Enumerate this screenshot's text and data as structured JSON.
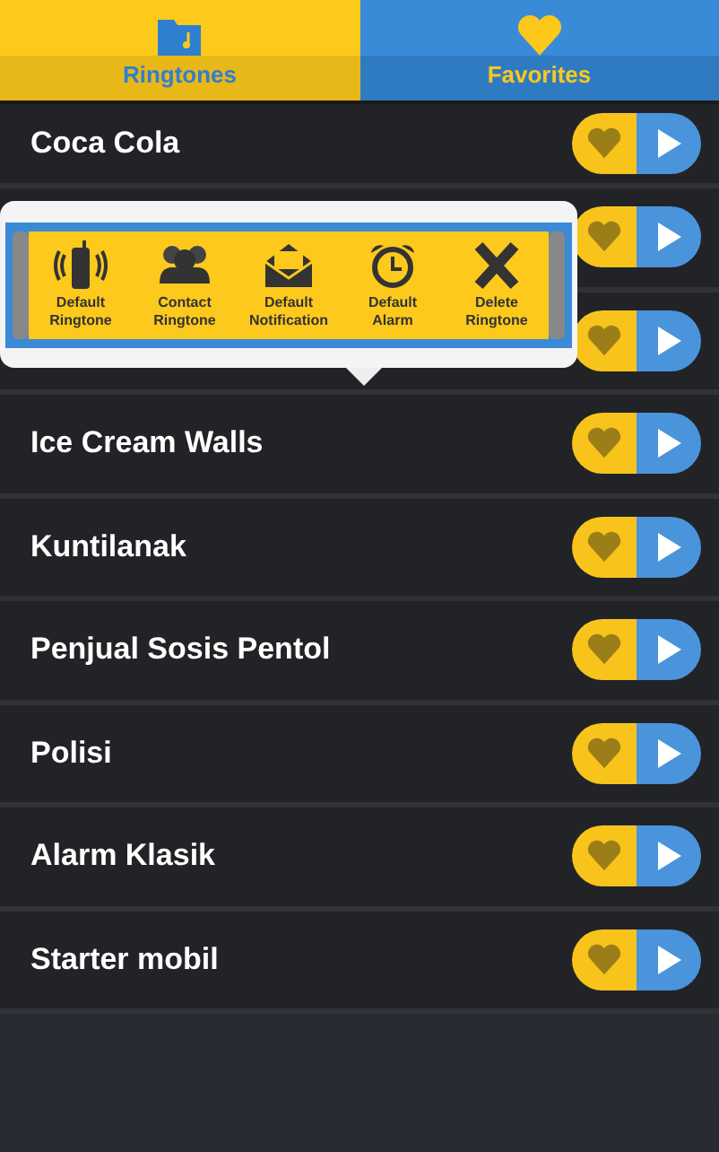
{
  "tabs": [
    {
      "label": "Ringtones",
      "selected": true
    },
    {
      "label": "Favorites",
      "selected": false
    }
  ],
  "rows": [
    {
      "name": "Coca Cola"
    },
    {},
    {},
    {
      "name": "Ice Cream Walls"
    },
    {
      "name": "Kuntilanak"
    },
    {
      "name": "Penjual Sosis Pentol"
    },
    {
      "name": "Polisi"
    },
    {
      "name": "Alarm Klasik"
    },
    {
      "name": "Starter mobil"
    }
  ],
  "popup": {
    "actions": [
      {
        "kind": "phone",
        "label": "Default Ringtone"
      },
      {
        "kind": "contacts",
        "label": "Contact Ringtone"
      },
      {
        "kind": "mail",
        "label": "Default Notification"
      },
      {
        "kind": "alarm",
        "label": "Default Alarm"
      },
      {
        "kind": "delete",
        "label": "Delete Ringtone"
      }
    ]
  }
}
